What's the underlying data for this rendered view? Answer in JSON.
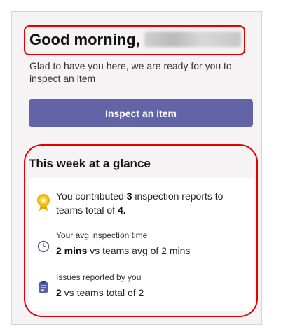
{
  "header": {
    "greeting": "Good morning,",
    "subtitle": "Glad to have you here, we are ready for you to inspect an item"
  },
  "actions": {
    "inspect_label": "Inspect an item"
  },
  "week": {
    "title": "This week at a glance",
    "contrib": {
      "prefix": "You contributed ",
      "count": "3",
      "middle": " inspection reports to teams total of ",
      "total": "4."
    },
    "avg": {
      "label": "Your avg inspection time",
      "value": "2 mins",
      "rest": " vs teams avg of 2 mins"
    },
    "issues": {
      "label": "Issues reported by you",
      "value": "2",
      "rest": " vs teams total of 2"
    }
  },
  "icons": {
    "badge": "medal-icon",
    "time": "clock-icon",
    "issues": "clipboard-icon"
  },
  "colors": {
    "accent": "#6264a7",
    "annotation": "#e30000",
    "medal": "#f2b500"
  }
}
